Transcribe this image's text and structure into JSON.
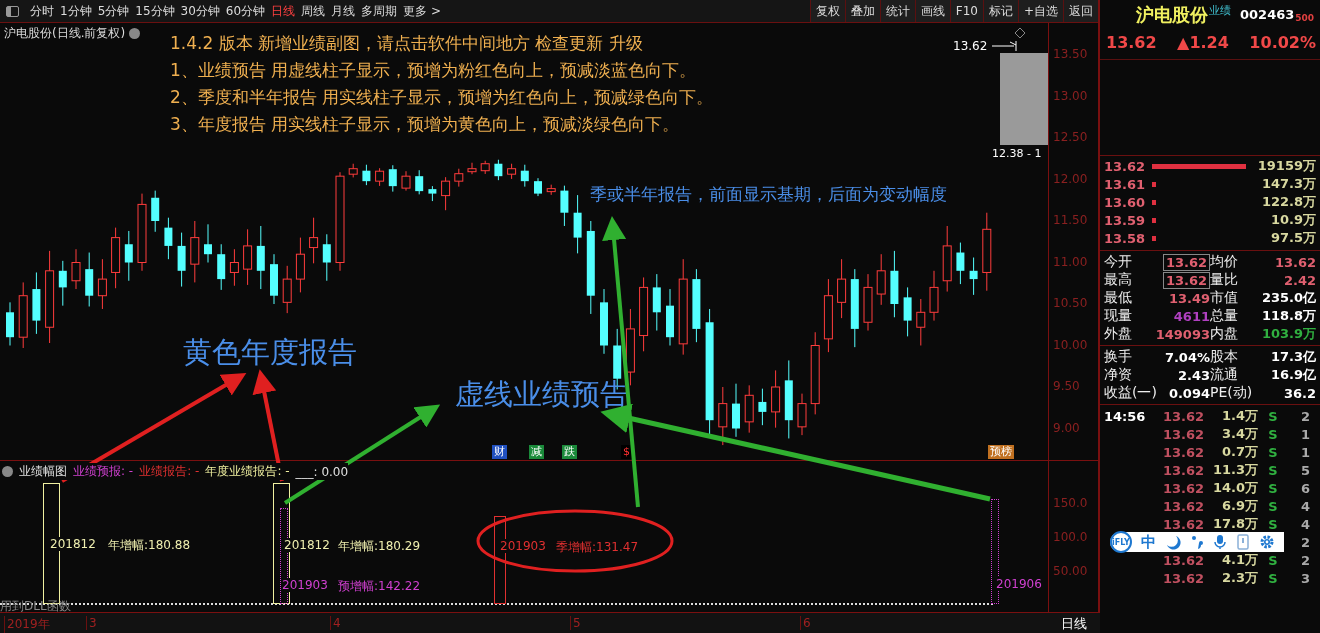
{
  "toolbar": {
    "periods": [
      {
        "label": "分时",
        "selected": false
      },
      {
        "label": "1分钟",
        "selected": false
      },
      {
        "label": "5分钟",
        "selected": false
      },
      {
        "label": "15分钟",
        "selected": false
      },
      {
        "label": "30分钟",
        "selected": false
      },
      {
        "label": "60分钟",
        "selected": false
      },
      {
        "label": "日线",
        "selected": true
      },
      {
        "label": "周线",
        "selected": false
      },
      {
        "label": "月线",
        "selected": false
      },
      {
        "label": "多周期",
        "selected": false
      },
      {
        "label": "更多 >",
        "selected": false
      }
    ],
    "buttons": [
      "复权",
      "叠加",
      "统计",
      "画线",
      "F10",
      "标记",
      "+自选",
      "返回"
    ]
  },
  "chart": {
    "title": "沪电股份(日线.前复权)",
    "notice": [
      "1.4.2 版本 新增业绩副图，请点击软件中间地方 检查更新 升级",
      "1、业绩预告 用虚线柱子显示，预增为粉红色向上，预减淡蓝色向下。",
      "2、季度和半年报告  用实线柱子显示，预增为红色向上，预减绿色向下。",
      "3、年度报告  用实线柱子显示，预增为黄色向上，预减淡绿色向下。"
    ],
    "callouts": [
      {
        "text": "季或半年报告，前面显示基期，后面为变动幅度",
        "kind": "small"
      },
      {
        "text": "黄色年度报告",
        "kind": "large"
      },
      {
        "text": "虚线业绩预告",
        "kind": "large"
      }
    ],
    "high_label": "13.62",
    "low_label": "12.38 - 1",
    "price_axis": [
      "13.50",
      "13.00",
      "12.50",
      "12.00",
      "11.50",
      "11.00",
      "10.50",
      "10.00",
      "9.50",
      "9.00"
    ],
    "markers": [
      {
        "text": "财",
        "color": "#2050c0"
      },
      {
        "text": "减",
        "color": "#1a8a3a"
      },
      {
        "text": "跌",
        "color": "#1a8a3a"
      },
      {
        "text": "$",
        "color": "#000000"
      },
      {
        "text": "预榜",
        "color": "#c07020"
      }
    ]
  },
  "indicator": {
    "legend": [
      {
        "text": "业绩幅图",
        "kind": "title"
      },
      {
        "text": "业绩预报: -",
        "kind": "forecast"
      },
      {
        "text": "业绩报告: -",
        "kind": "quarterly"
      },
      {
        "text": "年度业绩报告: -",
        "kind": "annual"
      },
      {
        "text": "___: 0.00",
        "kind": "title"
      }
    ],
    "bars": [
      {
        "kind": "annual",
        "period": "201812",
        "change": "年增幅:180.88"
      },
      {
        "kind": "annual",
        "period": "201812",
        "change": "年增幅:180.29"
      },
      {
        "kind": "forecast",
        "period": "201903",
        "change": "预增幅:142.22"
      },
      {
        "kind": "quarterly",
        "period": "201903",
        "change": "季增幅:131.47"
      },
      {
        "kind": "forecast",
        "period": "201906"
      }
    ],
    "note": "用到DLL函数",
    "axis": [
      "150.0",
      "100.0",
      "50.00"
    ]
  },
  "dates": [
    "2019年",
    "3",
    "4",
    "5",
    "6"
  ],
  "period_label": "日线",
  "quote": {
    "name": "沪电股份",
    "tag": "业绩",
    "code": "002463",
    "suffix": "500",
    "price": "13.62",
    "change": "▲1.24",
    "percent": "10.02%",
    "book": [
      {
        "price": "13.62",
        "volume": "19159万"
      },
      {
        "price": "13.61",
        "volume": "147.3万"
      },
      {
        "price": "13.60",
        "volume": "122.8万"
      },
      {
        "price": "13.59",
        "volume": "10.9万"
      },
      {
        "price": "13.58",
        "volume": "97.5万"
      }
    ],
    "stats": [
      [
        {
          "label": "今开",
          "value": "13.62",
          "color": "#e06070",
          "boxed": true
        },
        {
          "label": "均价",
          "value": "13.62",
          "color": "#e06070",
          "boxed": false
        }
      ],
      [
        {
          "label": "最高",
          "value": "13.62",
          "color": "#e06070",
          "boxed": true
        },
        {
          "label": "量比",
          "value": "2.42",
          "color": "#e06070",
          "boxed": false
        }
      ],
      [
        {
          "label": "最低",
          "value": "13.49",
          "color": "#e06070",
          "boxed": false
        },
        {
          "label": "市值",
          "value": "235.0亿",
          "color": "#ffffff",
          "boxed": false
        }
      ],
      [
        {
          "label": "现量",
          "value": "4611",
          "color": "#b040c0",
          "boxed": false
        },
        {
          "label": "总量",
          "value": "118.8万",
          "color": "#ffffff",
          "boxed": false
        }
      ],
      [
        {
          "label": "外盘",
          "value": "149093",
          "color": "#e06070",
          "boxed": false
        },
        {
          "label": "内盘",
          "value": "103.9万",
          "color": "#30b040",
          "boxed": false
        }
      ]
    ],
    "stats2": [
      [
        {
          "label": "换手",
          "value": "7.04%"
        },
        {
          "label": "股本",
          "value": "17.3亿"
        }
      ],
      [
        {
          "label": "净资",
          "value": "2.43"
        },
        {
          "label": "流通",
          "value": "16.9亿"
        }
      ],
      [
        {
          "label": "收益(一)",
          "value": "0.094"
        },
        {
          "label": "PE(动)",
          "value": "36.2"
        }
      ]
    ],
    "ticks": [
      {
        "time": "14:56",
        "price": "13.62",
        "volume": "1.4万",
        "side": "S",
        "count": "2"
      },
      {
        "price": "13.62",
        "volume": "3.4万",
        "side": "S",
        "count": "1"
      },
      {
        "price": "13.62",
        "volume": "0.7万",
        "side": "S",
        "count": "1"
      },
      {
        "price": "13.62",
        "volume": "11.3万",
        "side": "S",
        "count": "5"
      },
      {
        "price": "13.62",
        "volume": "14.0万",
        "side": "S",
        "count": "6"
      },
      {
        "price": "13.62",
        "volume": "6.9万",
        "side": "S",
        "count": "4"
      },
      {
        "price": "13.62",
        "volume": "17.8万",
        "side": "S",
        "count": "4"
      },
      {
        "count": "2"
      },
      {
        "price": "13.62",
        "volume": "4.1万",
        "side": "S",
        "count": "2"
      },
      {
        "price": "13.62",
        "volume": "2.3万",
        "side": "S",
        "count": "3"
      }
    ]
  },
  "ime_bar": {
    "logo": "iFLY",
    "mode": "中"
  }
}
